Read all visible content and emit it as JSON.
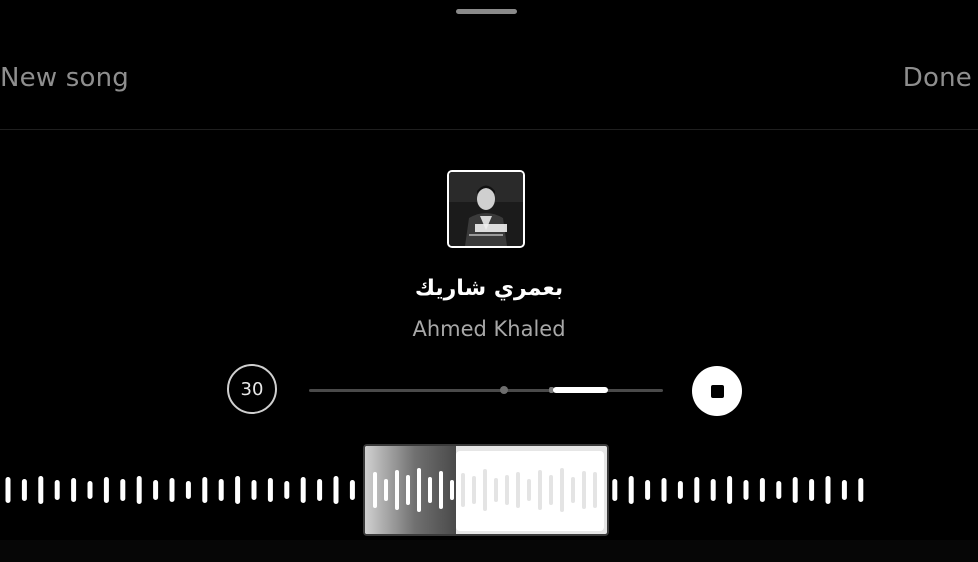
{
  "header": {
    "left_label": "New song",
    "right_label": "Done"
  },
  "song": {
    "title": "بعمري شاريك",
    "artist": "Ahmed Khaled",
    "cover_icon": "album-cover-image"
  },
  "controls": {
    "clip_duration": "30",
    "stop_icon": "stop-icon",
    "playback_progress": 0.7
  },
  "colors": {
    "background": "#000000",
    "header_text": "#8e8e8e",
    "artist_text": "#a8a8a8",
    "accent": "#ffffff"
  }
}
